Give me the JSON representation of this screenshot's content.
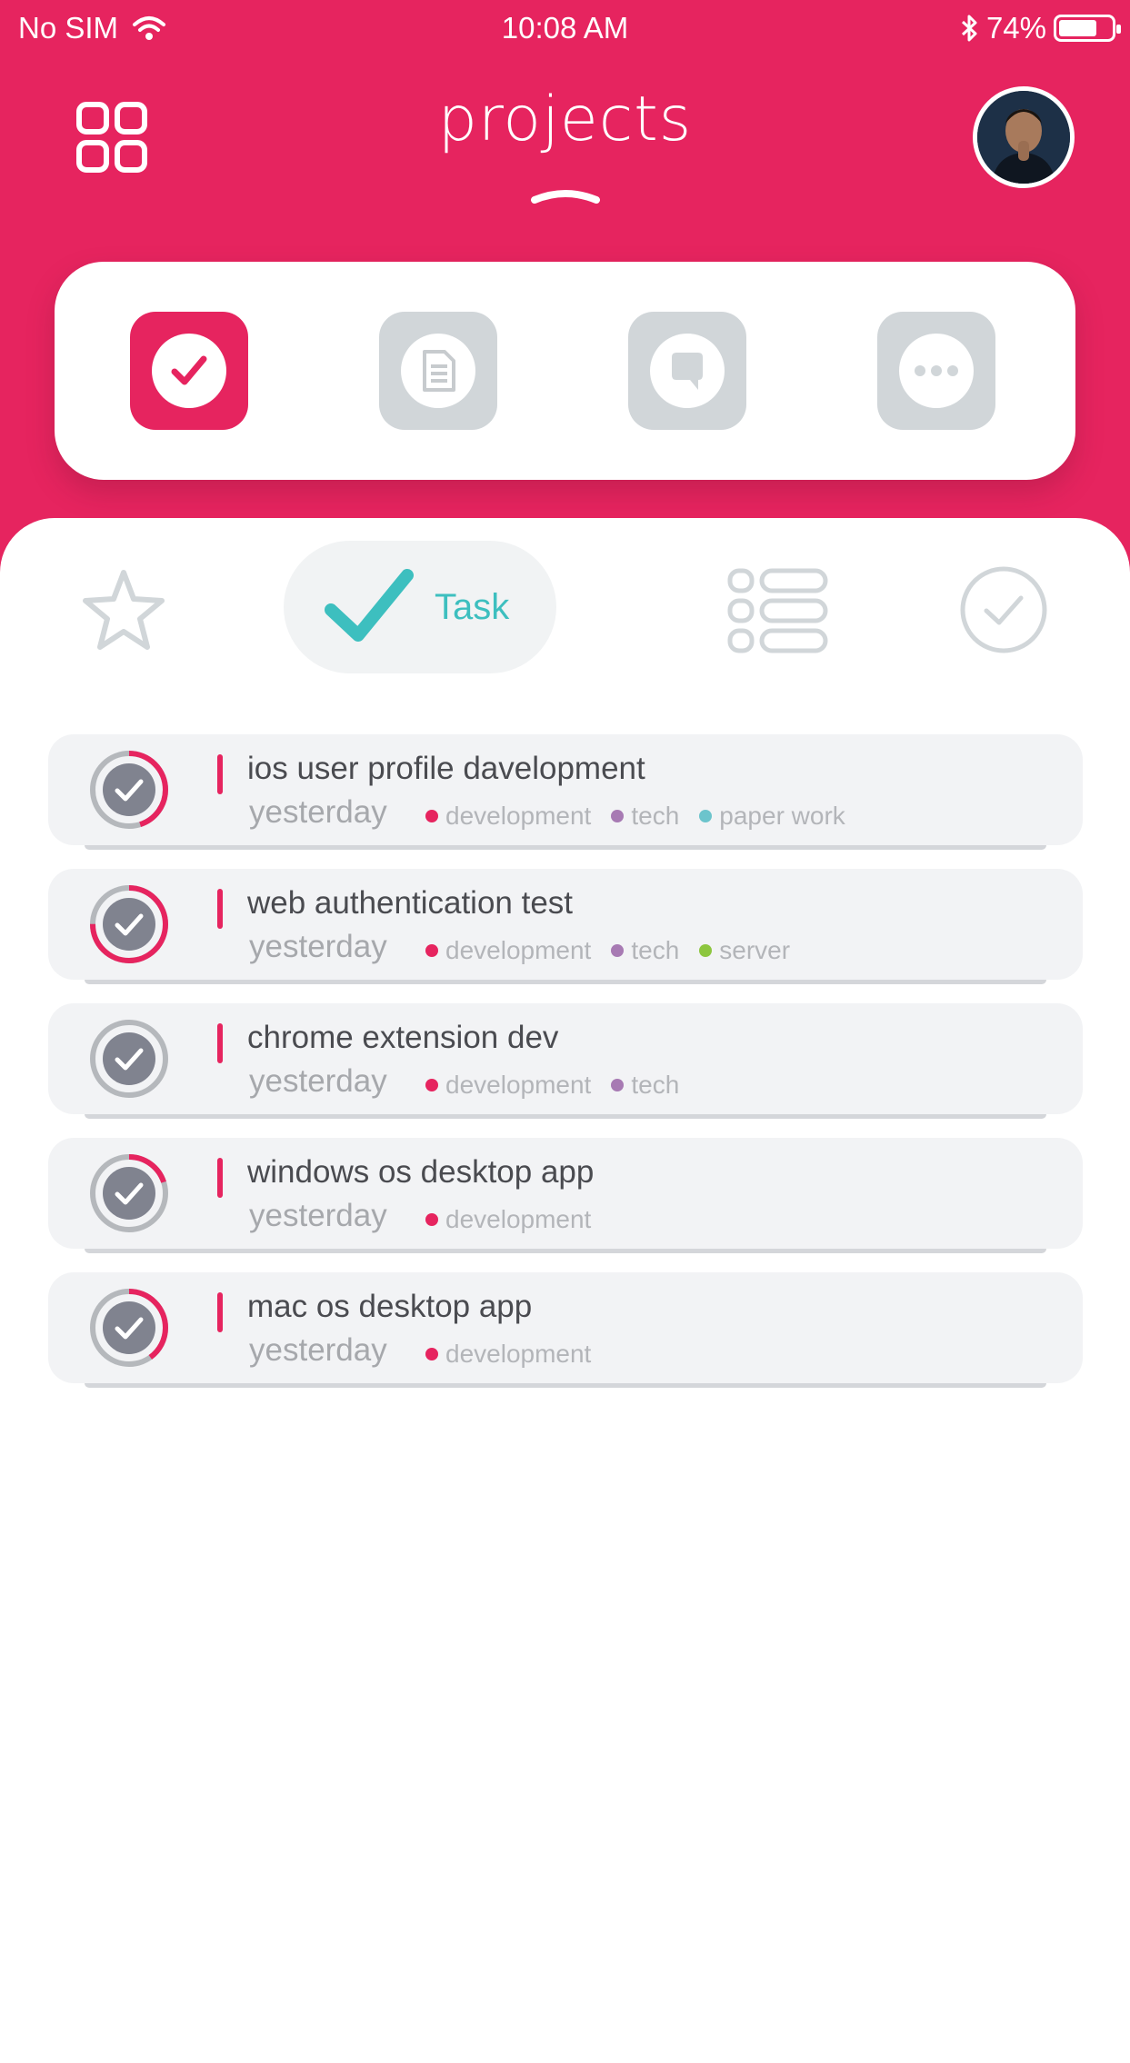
{
  "status_bar": {
    "carrier": "No SIM",
    "time": "10:08 AM",
    "battery": "74%",
    "battery_level": 0.74
  },
  "header": {
    "title": "projects",
    "menu_icon": "grid-icon",
    "avatar_icon": "user-avatar"
  },
  "categories": [
    {
      "name": "tasks",
      "icon": "check-icon",
      "active": true
    },
    {
      "name": "notes",
      "icon": "document-icon",
      "active": false
    },
    {
      "name": "messages",
      "icon": "chat-icon",
      "active": false
    },
    {
      "name": "more",
      "icon": "more-icon",
      "active": false
    }
  ],
  "tabs": [
    {
      "name": "favorites",
      "icon": "star-icon"
    },
    {
      "name": "task",
      "label": "Task",
      "icon": "check-icon",
      "active": true
    },
    {
      "name": "list",
      "icon": "list-icon"
    },
    {
      "name": "done",
      "icon": "check-circle-icon"
    }
  ],
  "tasks": [
    {
      "name": "ios user profile davelopment",
      "when": "yesterday",
      "progress": 0.45,
      "tags": [
        {
          "label": "development",
          "color": "#e6245f"
        },
        {
          "label": "tech",
          "color": "#a77ab3"
        },
        {
          "label": "paper work",
          "color": "#6cc4cc"
        }
      ]
    },
    {
      "name": "web authentication test",
      "when": "yesterday",
      "progress": 0.75,
      "tags": [
        {
          "label": "development",
          "color": "#e6245f"
        },
        {
          "label": "tech",
          "color": "#a77ab3"
        },
        {
          "label": "server",
          "color": "#8dc63f"
        }
      ]
    },
    {
      "name": "chrome extension dev",
      "when": "yesterday",
      "progress": 0.0,
      "tags": [
        {
          "label": "development",
          "color": "#e6245f"
        },
        {
          "label": "tech",
          "color": "#a77ab3"
        }
      ]
    },
    {
      "name": "windows os desktop app",
      "when": "yesterday",
      "progress": 0.2,
      "tags": [
        {
          "label": "development",
          "color": "#e6245f"
        }
      ]
    },
    {
      "name": "mac os desktop app",
      "when": "yesterday",
      "progress": 0.4,
      "tags": [
        {
          "label": "development",
          "color": "#e6245f"
        }
      ]
    }
  ],
  "colors": {
    "accent": "#e6245f",
    "teal": "#3dbfbf",
    "muted": "#d1d6d9"
  }
}
